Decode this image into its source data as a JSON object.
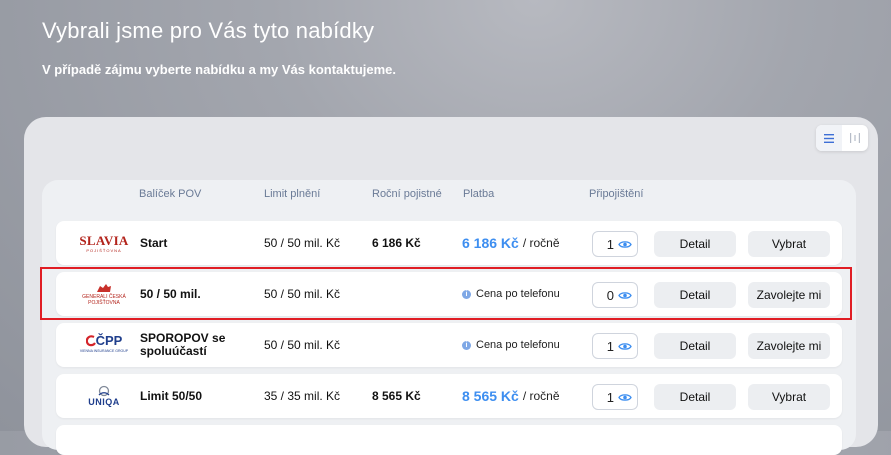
{
  "header": {
    "title": "Vybrali jsme pro Vás tyto nabídky",
    "subtitle": "V případě zájmu vyberte nabídku a my Vás kontaktujeme."
  },
  "view_toggle": {
    "list_icon": "list-view-icon",
    "columns_icon": "columns-view-icon"
  },
  "columns": {
    "package": "Balíček POV",
    "limit": "Limit plnění",
    "annual": "Roční pojistné",
    "payment": "Platba",
    "extras": "Připojištění"
  },
  "colors": {
    "accent": "#3d8ef0",
    "highlight": "#e01d24"
  },
  "rows": [
    {
      "insurer_logo": "SLAVIA",
      "insurer_sub": "POJIŠŤOVNA",
      "package": "Start",
      "limit": "50 / 50 mil. Kč",
      "annual": "6 186 Kč",
      "payment_amount": "6 186 Kč",
      "payment_period": "/ ročně",
      "payment_info": "",
      "extras_count": "1",
      "detail_label": "Detail",
      "action_label": "Vybrat"
    },
    {
      "insurer_logo": "GENERALI ČESKÁ POJIŠŤOVNA",
      "insurer_sub": "",
      "package": "50 / 50 mil.",
      "limit": "50 / 50 mil. Kč",
      "annual": "",
      "payment_amount": "",
      "payment_period": "",
      "payment_info": "Cena po telefonu",
      "extras_count": "0",
      "detail_label": "Detail",
      "action_label": "Zavolejte mi"
    },
    {
      "insurer_logo": "ČPP",
      "insurer_sub": "VIENNA INSURANCE GROUP",
      "package": "SPOROPOV se spoluúčastí",
      "limit": "50 / 50 mil. Kč",
      "annual": "",
      "payment_amount": "",
      "payment_period": "",
      "payment_info": "Cena po telefonu",
      "extras_count": "1",
      "detail_label": "Detail",
      "action_label": "Zavolejte mi"
    },
    {
      "insurer_logo": "UNIQA",
      "insurer_sub": "",
      "package": "Limit 50/50",
      "limit": "35 / 35 mil. Kč",
      "annual": "8 565 Kč",
      "payment_amount": "8 565 Kč",
      "payment_period": "/ ročně",
      "payment_info": "",
      "extras_count": "1",
      "detail_label": "Detail",
      "action_label": "Vybrat"
    }
  ]
}
